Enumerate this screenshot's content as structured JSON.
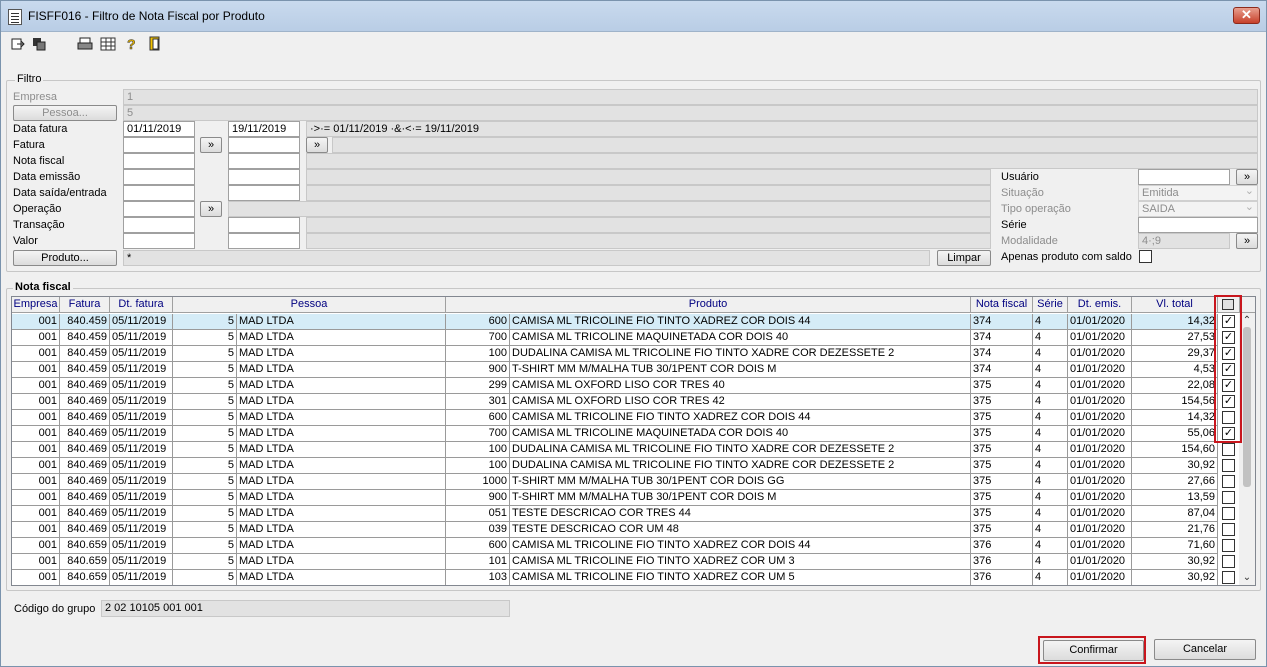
{
  "window": {
    "title": "FISFF016 - Filtro de Nota Fiscal por Produto",
    "close_label": "✕"
  },
  "filter": {
    "group_label": "Filtro",
    "empresa_label": "Empresa",
    "empresa_value": "1",
    "pessoa_button": "Pessoa...",
    "pessoa_value": "5",
    "data_fatura_label": "Data fatura",
    "data_fatura_from": "01/11/2019",
    "data_fatura_to": "19/11/2019",
    "data_fatura_expr": "·>·= 01/11/2019 ·&·<·= 19/11/2019",
    "fatura_label": "Fatura",
    "nota_fiscal_label": "Nota fiscal",
    "data_emissao_label": "Data emissão",
    "data_saida_label": "Data saída/entrada",
    "operacao_label": "Operação",
    "transacao_label": "Transação",
    "valor_label": "Valor",
    "produto_button": "Produto...",
    "produto_value": "*",
    "limpar_button": "Limpar",
    "lookup_label": "»",
    "usuario_label": "Usuário",
    "situacao_label": "Situação",
    "situacao_value": "Emitida",
    "tipo_operacao_label": "Tipo operação",
    "tipo_operacao_value": "SAIDA",
    "serie_label": "Série",
    "modalidade_label": "Modalidade",
    "modalidade_value": "4·;9",
    "apenas_saldo_label": "Apenas produto com saldo"
  },
  "nota": {
    "group_label": "Nota fiscal",
    "columns": [
      "Empresa",
      "Fatura",
      "Dt. fatura",
      "Pessoa",
      "Produto",
      "Nota fiscal",
      "Série",
      "Dt. emis.",
      "Vl. total"
    ],
    "rows": [
      {
        "empresa": "001",
        "fatura": "840.459",
        "dt_fatura": "05/11/2019",
        "pessoa_cod": "5",
        "pessoa": "MAD LTDA",
        "prod_cod": "600",
        "produto": "CAMISA ML TRICOLINE FIO TINTO XADREZ COR DOIS 44",
        "nf": "374",
        "serie": "4",
        "dt_emis": "01/01/2020",
        "vl": "14,32",
        "chk": true
      },
      {
        "empresa": "001",
        "fatura": "840.459",
        "dt_fatura": "05/11/2019",
        "pessoa_cod": "5",
        "pessoa": "MAD LTDA",
        "prod_cod": "700",
        "produto": "CAMISA ML TRICOLINE MAQUINETADA COR DOIS 40",
        "nf": "374",
        "serie": "4",
        "dt_emis": "01/01/2020",
        "vl": "27,53",
        "chk": true
      },
      {
        "empresa": "001",
        "fatura": "840.459",
        "dt_fatura": "05/11/2019",
        "pessoa_cod": "5",
        "pessoa": "MAD LTDA",
        "prod_cod": "100",
        "produto": "DUDALINA CAMISA ML TRICOLINE FIO TINTO XADRE COR DEZESSETE 2",
        "nf": "374",
        "serie": "4",
        "dt_emis": "01/01/2020",
        "vl": "29,37",
        "chk": true
      },
      {
        "empresa": "001",
        "fatura": "840.459",
        "dt_fatura": "05/11/2019",
        "pessoa_cod": "5",
        "pessoa": "MAD LTDA",
        "prod_cod": "900",
        "produto": "T-SHIRT MM M/MALHA TUB 30/1PENT COR DOIS M",
        "nf": "374",
        "serie": "4",
        "dt_emis": "01/01/2020",
        "vl": "4,53",
        "chk": true
      },
      {
        "empresa": "001",
        "fatura": "840.469",
        "dt_fatura": "05/11/2019",
        "pessoa_cod": "5",
        "pessoa": "MAD LTDA",
        "prod_cod": "299",
        "produto": "CAMISA ML OXFORD LISO COR TRES 40",
        "nf": "375",
        "serie": "4",
        "dt_emis": "01/01/2020",
        "vl": "22,08",
        "chk": true
      },
      {
        "empresa": "001",
        "fatura": "840.469",
        "dt_fatura": "05/11/2019",
        "pessoa_cod": "5",
        "pessoa": "MAD LTDA",
        "prod_cod": "301",
        "produto": "CAMISA ML OXFORD LISO COR TRES 42",
        "nf": "375",
        "serie": "4",
        "dt_emis": "01/01/2020",
        "vl": "154,56",
        "chk": true
      },
      {
        "empresa": "001",
        "fatura": "840.469",
        "dt_fatura": "05/11/2019",
        "pessoa_cod": "5",
        "pessoa": "MAD LTDA",
        "prod_cod": "600",
        "produto": "CAMISA ML TRICOLINE FIO TINTO XADREZ COR DOIS 44",
        "nf": "375",
        "serie": "4",
        "dt_emis": "01/01/2020",
        "vl": "14,32",
        "chk": false
      },
      {
        "empresa": "001",
        "fatura": "840.469",
        "dt_fatura": "05/11/2019",
        "pessoa_cod": "5",
        "pessoa": "MAD LTDA",
        "prod_cod": "700",
        "produto": "CAMISA ML TRICOLINE MAQUINETADA COR DOIS 40",
        "nf": "375",
        "serie": "4",
        "dt_emis": "01/01/2020",
        "vl": "55,06",
        "chk": true
      },
      {
        "empresa": "001",
        "fatura": "840.469",
        "dt_fatura": "05/11/2019",
        "pessoa_cod": "5",
        "pessoa": "MAD LTDA",
        "prod_cod": "100",
        "produto": "DUDALINA CAMISA ML TRICOLINE FIO TINTO XADRE COR DEZESSETE 2",
        "nf": "375",
        "serie": "4",
        "dt_emis": "01/01/2020",
        "vl": "154,60",
        "chk": false
      },
      {
        "empresa": "001",
        "fatura": "840.469",
        "dt_fatura": "05/11/2019",
        "pessoa_cod": "5",
        "pessoa": "MAD LTDA",
        "prod_cod": "100",
        "produto": "DUDALINA CAMISA ML TRICOLINE FIO TINTO XADRE COR DEZESSETE 2",
        "nf": "375",
        "serie": "4",
        "dt_emis": "01/01/2020",
        "vl": "30,92",
        "chk": false
      },
      {
        "empresa": "001",
        "fatura": "840.469",
        "dt_fatura": "05/11/2019",
        "pessoa_cod": "5",
        "pessoa": "MAD LTDA",
        "prod_cod": "1000",
        "produto": "T-SHIRT MM M/MALHA TUB 30/1PENT COR DOIS GG",
        "nf": "375",
        "serie": "4",
        "dt_emis": "01/01/2020",
        "vl": "27,66",
        "chk": false
      },
      {
        "empresa": "001",
        "fatura": "840.469",
        "dt_fatura": "05/11/2019",
        "pessoa_cod": "5",
        "pessoa": "MAD LTDA",
        "prod_cod": "900",
        "produto": "T-SHIRT MM M/MALHA TUB 30/1PENT COR DOIS M",
        "nf": "375",
        "serie": "4",
        "dt_emis": "01/01/2020",
        "vl": "13,59",
        "chk": false
      },
      {
        "empresa": "001",
        "fatura": "840.469",
        "dt_fatura": "05/11/2019",
        "pessoa_cod": "5",
        "pessoa": "MAD LTDA",
        "prod_cod": "051",
        "produto": "TESTE DESCRICAO COR TRES 44",
        "nf": "375",
        "serie": "4",
        "dt_emis": "01/01/2020",
        "vl": "87,04",
        "chk": false
      },
      {
        "empresa": "001",
        "fatura": "840.469",
        "dt_fatura": "05/11/2019",
        "pessoa_cod": "5",
        "pessoa": "MAD LTDA",
        "prod_cod": "039",
        "produto": "TESTE DESCRICAO COR UM 48",
        "nf": "375",
        "serie": "4",
        "dt_emis": "01/01/2020",
        "vl": "21,76",
        "chk": false
      },
      {
        "empresa": "001",
        "fatura": "840.659",
        "dt_fatura": "05/11/2019",
        "pessoa_cod": "5",
        "pessoa": "MAD LTDA",
        "prod_cod": "600",
        "produto": "CAMISA ML TRICOLINE FIO TINTO XADREZ COR DOIS 44",
        "nf": "376",
        "serie": "4",
        "dt_emis": "01/01/2020",
        "vl": "71,60",
        "chk": false
      },
      {
        "empresa": "001",
        "fatura": "840.659",
        "dt_fatura": "05/11/2019",
        "pessoa_cod": "5",
        "pessoa": "MAD LTDA",
        "prod_cod": "101",
        "produto": "CAMISA ML TRICOLINE FIO TINTO XADREZ COR UM 3",
        "nf": "376",
        "serie": "4",
        "dt_emis": "01/01/2020",
        "vl": "30,92",
        "chk": false
      },
      {
        "empresa": "001",
        "fatura": "840.659",
        "dt_fatura": "05/11/2019",
        "pessoa_cod": "5",
        "pessoa": "MAD LTDA",
        "prod_cod": "103",
        "produto": "CAMISA ML TRICOLINE FIO TINTO XADREZ COR UM 5",
        "nf": "376",
        "serie": "4",
        "dt_emis": "01/01/2020",
        "vl": "30,92",
        "chk": false
      }
    ]
  },
  "codigo_grupo": {
    "label": "Código do grupo",
    "value": "2 02 10105 001 001"
  },
  "footer": {
    "confirmar": "Confirmar",
    "cancelar": "Cancelar"
  },
  "colors": {
    "highlight": "#c8161d",
    "selected_row": "#d5ecf7",
    "header_text": "#000080"
  },
  "icons": [
    "exit-icon",
    "filter-icon",
    "print-icon",
    "grid-icon",
    "help-icon",
    "door-icon"
  ]
}
